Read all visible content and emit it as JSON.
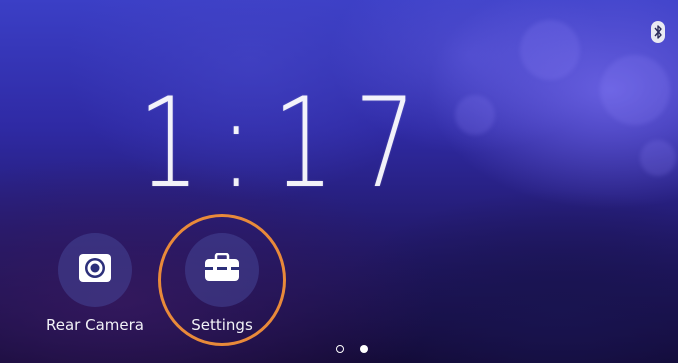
{
  "status_bar": {
    "bluetooth_icon": "bluetooth-icon"
  },
  "clock": {
    "time": "1:17"
  },
  "apps": [
    {
      "label": "Rear Camera",
      "icon": "camera-icon"
    },
    {
      "label": "Settings",
      "icon": "toolbox-icon"
    }
  ],
  "pager": {
    "total_pages": 2,
    "current_page": 2
  },
  "colors": {
    "highlight_ring": "#e98a3a",
    "background_top": "#3b3fc6",
    "background_bottom": "#120a34"
  }
}
